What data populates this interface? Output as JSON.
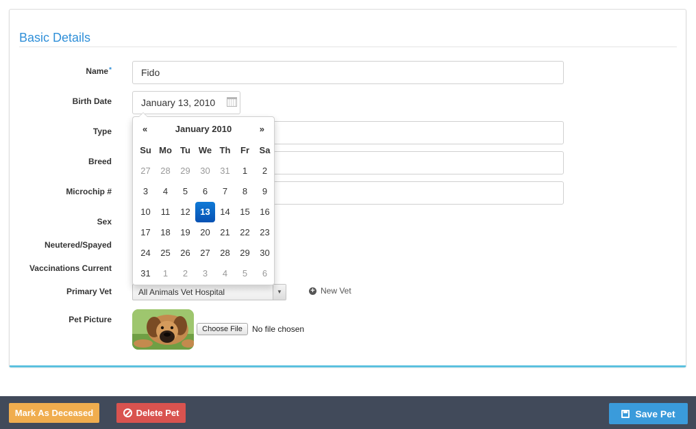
{
  "section": {
    "title": "Basic Details"
  },
  "labels": {
    "name": "Name",
    "required_marker": "*",
    "birth_date": "Birth Date",
    "type": "Type",
    "breed": "Breed",
    "microchip": "Microchip #",
    "sex": "Sex",
    "neutered": "Neutered/Spayed",
    "vaccinations": "Vaccinations Current",
    "primary_vet": "Primary Vet",
    "pet_picture": "Pet Picture"
  },
  "fields": {
    "name_value": "Fido",
    "birth_date_value": "January 13, 2010",
    "type_value": "",
    "breed_value": "",
    "microchip_value": "",
    "primary_vet_value": "All Animals Vet Hospital"
  },
  "new_vet_label": "New Vet",
  "file": {
    "button": "Choose File",
    "status": "No file chosen"
  },
  "datepicker": {
    "prev": "«",
    "next": "»",
    "title": "January 2010",
    "weekdays": [
      "Su",
      "Mo",
      "Tu",
      "We",
      "Th",
      "Fr",
      "Sa"
    ],
    "selected_day": 13,
    "days": [
      {
        "d": "27",
        "old": true
      },
      {
        "d": "28",
        "old": true
      },
      {
        "d": "29",
        "old": true
      },
      {
        "d": "30",
        "old": true
      },
      {
        "d": "31",
        "old": true
      },
      {
        "d": "1"
      },
      {
        "d": "2"
      },
      {
        "d": "3"
      },
      {
        "d": "4"
      },
      {
        "d": "5"
      },
      {
        "d": "6"
      },
      {
        "d": "7"
      },
      {
        "d": "8"
      },
      {
        "d": "9"
      },
      {
        "d": "10"
      },
      {
        "d": "11"
      },
      {
        "d": "12"
      },
      {
        "d": "13",
        "sel": true
      },
      {
        "d": "14"
      },
      {
        "d": "15"
      },
      {
        "d": "16"
      },
      {
        "d": "17"
      },
      {
        "d": "18"
      },
      {
        "d": "19"
      },
      {
        "d": "20"
      },
      {
        "d": "21"
      },
      {
        "d": "22"
      },
      {
        "d": "23"
      },
      {
        "d": "24"
      },
      {
        "d": "25"
      },
      {
        "d": "26"
      },
      {
        "d": "27"
      },
      {
        "d": "28"
      },
      {
        "d": "29"
      },
      {
        "d": "30"
      },
      {
        "d": "31"
      },
      {
        "d": "1",
        "old": true
      },
      {
        "d": "2",
        "old": true
      },
      {
        "d": "3",
        "old": true
      },
      {
        "d": "4",
        "old": true
      },
      {
        "d": "5",
        "old": true
      },
      {
        "d": "6",
        "old": true
      }
    ]
  },
  "footer": {
    "deceased_label": "Mark As Deceased",
    "delete_label": "Delete Pet",
    "save_label": "Save Pet"
  },
  "colors": {
    "accent": "#2f8fd8",
    "footer_bg": "#414a5a",
    "warning": "#f0ad4e",
    "danger": "#d9534f",
    "primary": "#3a9bdb",
    "selected_day": "#0852b3"
  },
  "icons": [
    "calendar-icon",
    "plus-circle-icon",
    "ban-icon",
    "save-icon",
    "chevron-down-icon"
  ]
}
